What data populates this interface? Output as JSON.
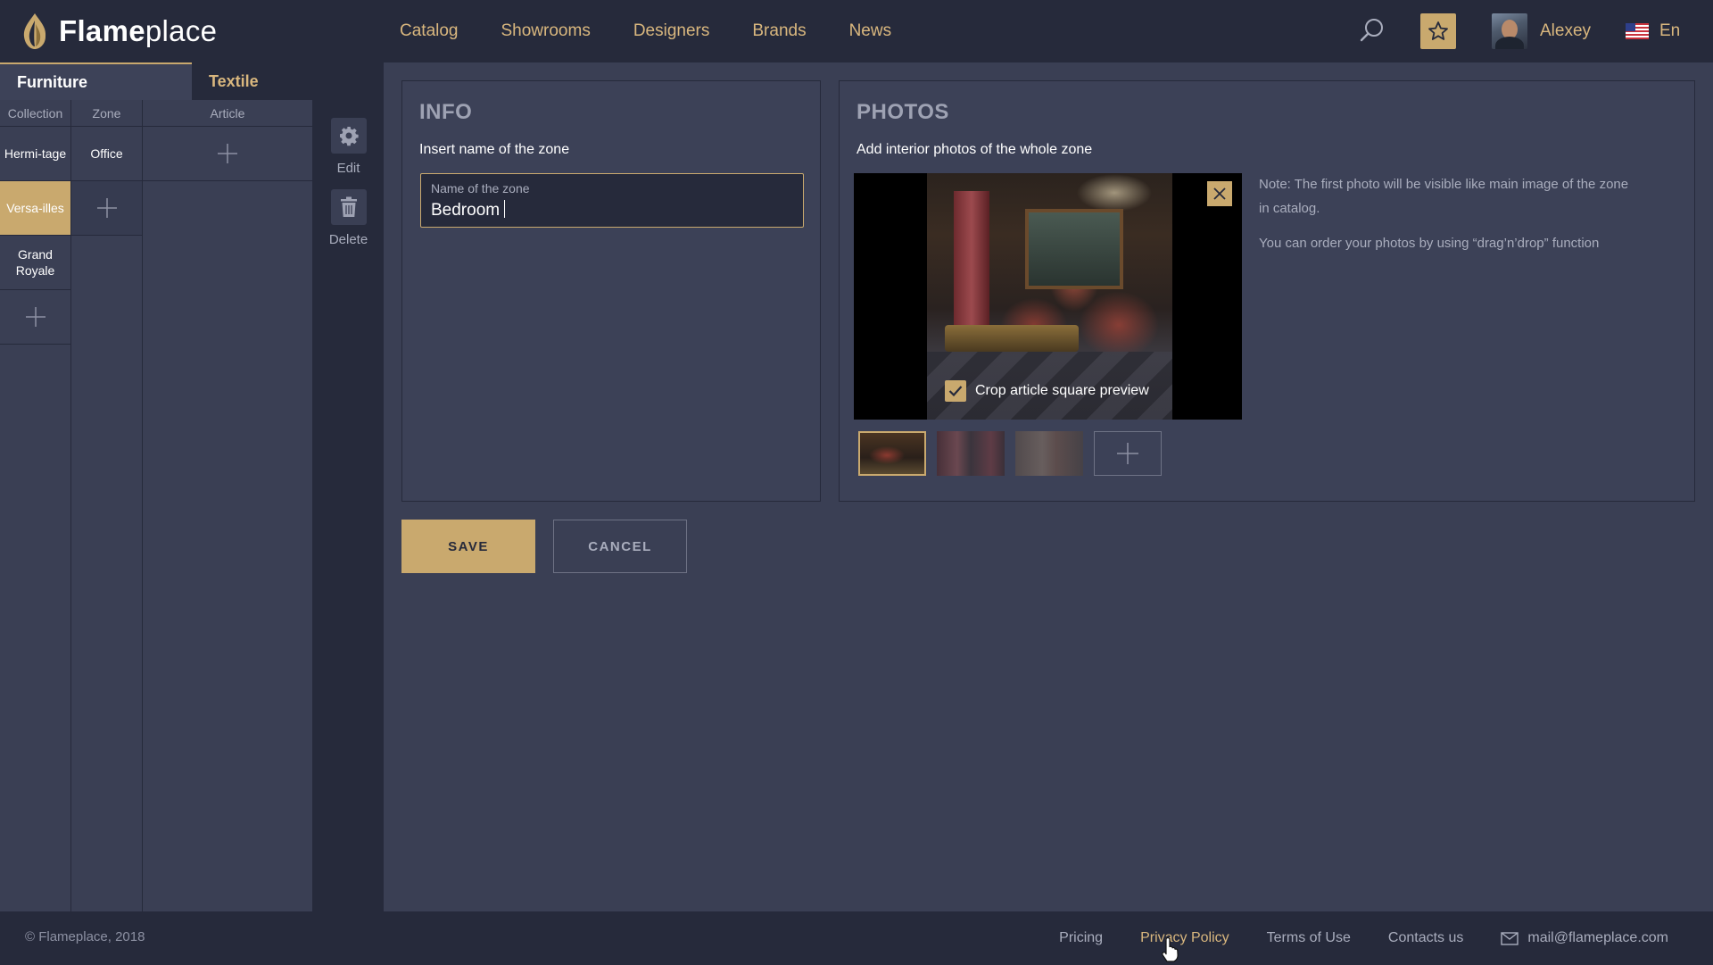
{
  "brand": {
    "bold": "Flame",
    "light": "place",
    "logo_icon": "flame-logo-icon"
  },
  "nav": [
    "Catalog",
    "Showrooms",
    "Designers",
    "Brands",
    "News"
  ],
  "header": {
    "search_icon": "search-icon",
    "favorites_icon": "star-icon",
    "user_name": "Alexey",
    "language": "En"
  },
  "tabs": {
    "furniture": "Furniture",
    "textile": "Textile"
  },
  "columns": {
    "collection": {
      "header": "Collection",
      "items": [
        "Hermi-tage",
        "Versa-illes",
        "Grand Royale"
      ],
      "active_index": 1
    },
    "zone": {
      "header": "Zone",
      "items": [
        "Office"
      ]
    },
    "article": {
      "header": "Article"
    }
  },
  "tools": {
    "edit": "Edit",
    "delete": "Delete"
  },
  "info": {
    "title": "INFO",
    "subtitle": "Insert name of the zone",
    "field_label": "Name of the zone",
    "field_value": "Bedroom"
  },
  "photos": {
    "title": "PHOTOS",
    "subtitle": "Add interior photos of the whole zone",
    "crop_label": "Crop article square preview",
    "crop_checked": true,
    "note_1": "Note: The first photo will be visible like main image of the zone in catalog.",
    "note_2": "You can order your photos by using “drag’n’drop” function",
    "thumbnail_count": 3
  },
  "buttons": {
    "save": "SAVE",
    "cancel": "CANCEL"
  },
  "footer": {
    "copyright": "© Flameplace, 2018",
    "links": [
      "Pricing",
      "Privacy Policy",
      "Terms of Use",
      "Contacts us"
    ],
    "email": "mail@flameplace.com"
  },
  "colors": {
    "accent": "#c9a96e",
    "header_bg": "#262a3b",
    "content_bg": "#3a3f54",
    "link": "#d9b77e"
  }
}
